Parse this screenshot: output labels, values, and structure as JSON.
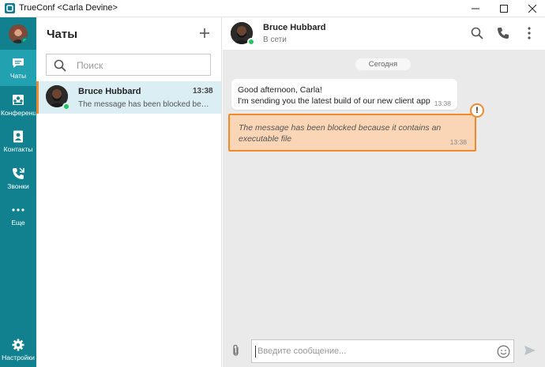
{
  "window": {
    "title": "TrueConf <Carla Devine>"
  },
  "nav": {
    "items": [
      {
        "label": "Чаты",
        "icon": "chat-icon"
      },
      {
        "label": "Конференции",
        "icon": "conference-icon"
      },
      {
        "label": "Контакты",
        "icon": "contacts-icon"
      },
      {
        "label": "Звонки",
        "icon": "calls-icon"
      },
      {
        "label": "Еще",
        "icon": "more-icon"
      }
    ],
    "settings_label": "Настройки"
  },
  "chat_list": {
    "title": "Чаты",
    "search_placeholder": "Поиск",
    "items": [
      {
        "name": "Bruce Hubbard",
        "time": "13:38",
        "preview": "The message has been blocked because it contains an executable file"
      }
    ]
  },
  "conversation": {
    "contact_name": "Bruce Hubbard",
    "contact_status": "В сети",
    "date_divider": "Сегодня",
    "messages": [
      {
        "line1": "Good afternoon, Carla!",
        "line2": "I'm sending you the latest build of our new client app",
        "time": "13:38"
      },
      {
        "line1": "The message has been blocked because it contains an",
        "line2": "executable file",
        "time": "13:38",
        "warning_mark": "!"
      }
    ],
    "composer_placeholder": "Введите сообщение..."
  },
  "colors": {
    "rail": "#12818f",
    "rail_active": "#22a1b0",
    "accent_orange": "#f08a2c",
    "blocked_fill": "#fbd6b6",
    "online": "#22c55e"
  }
}
